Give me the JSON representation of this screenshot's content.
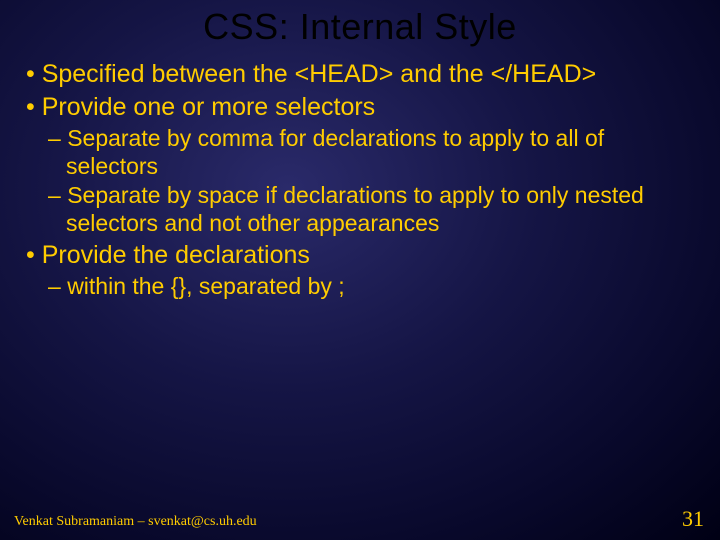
{
  "title": "CSS: Internal Style",
  "bullets": {
    "b1a": "Specified between the <HEAD> and the </HEAD>",
    "b1b": "Provide one or more selectors",
    "b2a": "Separate by comma for declarations to apply to all of selectors",
    "b2b": "Separate by space if declarations to apply to only nested selectors and not other appearances",
    "b1c": "Provide the declarations",
    "b2c": "within the {}, separated by ;"
  },
  "footer": {
    "author": "Venkat Subramaniam – svenkat@cs.uh.edu",
    "page": "31"
  }
}
